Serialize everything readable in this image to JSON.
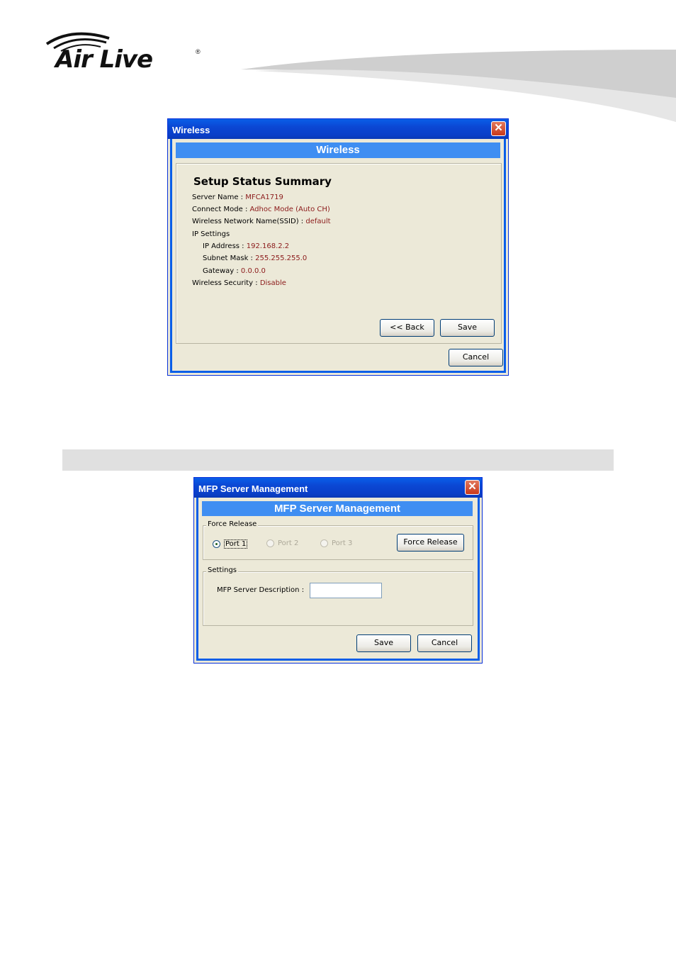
{
  "header": {
    "logo_text": "Air Live",
    "logo_reg_mark": "®"
  },
  "wireless_dialog": {
    "window_title": "Wireless",
    "banner": "Wireless",
    "summary_title": "Setup Status Summary",
    "fields": [
      {
        "label": "Server Name :",
        "value": "MFCA1719"
      },
      {
        "label": "Connect Mode :",
        "value": "Adhoc Mode (Auto CH)"
      },
      {
        "label": "Wireless Network Name(SSID) :",
        "value": "default"
      },
      {
        "label": "IP Settings",
        "value": ""
      },
      {
        "label": "IP Address :",
        "value": "192.168.2.2"
      },
      {
        "label": "Subnet Mask :",
        "value": "255.255.255.0"
      },
      {
        "label": "Gateway :",
        "value": "0.0.0.0"
      },
      {
        "label": "Wireless Security :",
        "value": "Disable"
      }
    ],
    "back_button": "<< Back",
    "save_button": "Save",
    "cancel_button": "Cancel"
  },
  "mfp_dialog": {
    "window_title": "MFP Server Management",
    "banner": "MFP Server Management",
    "force_release_group": "Force Release",
    "ports": [
      {
        "label": "Port 1",
        "selected": true,
        "enabled": true
      },
      {
        "label": "Port 2",
        "selected": false,
        "enabled": false
      },
      {
        "label": "Port 3",
        "selected": false,
        "enabled": false
      }
    ],
    "force_release_button": "Force Release",
    "settings_group": "Settings",
    "description_label": "MFP Server Description :",
    "description_value": "",
    "save_button": "Save",
    "cancel_button": "Cancel"
  }
}
